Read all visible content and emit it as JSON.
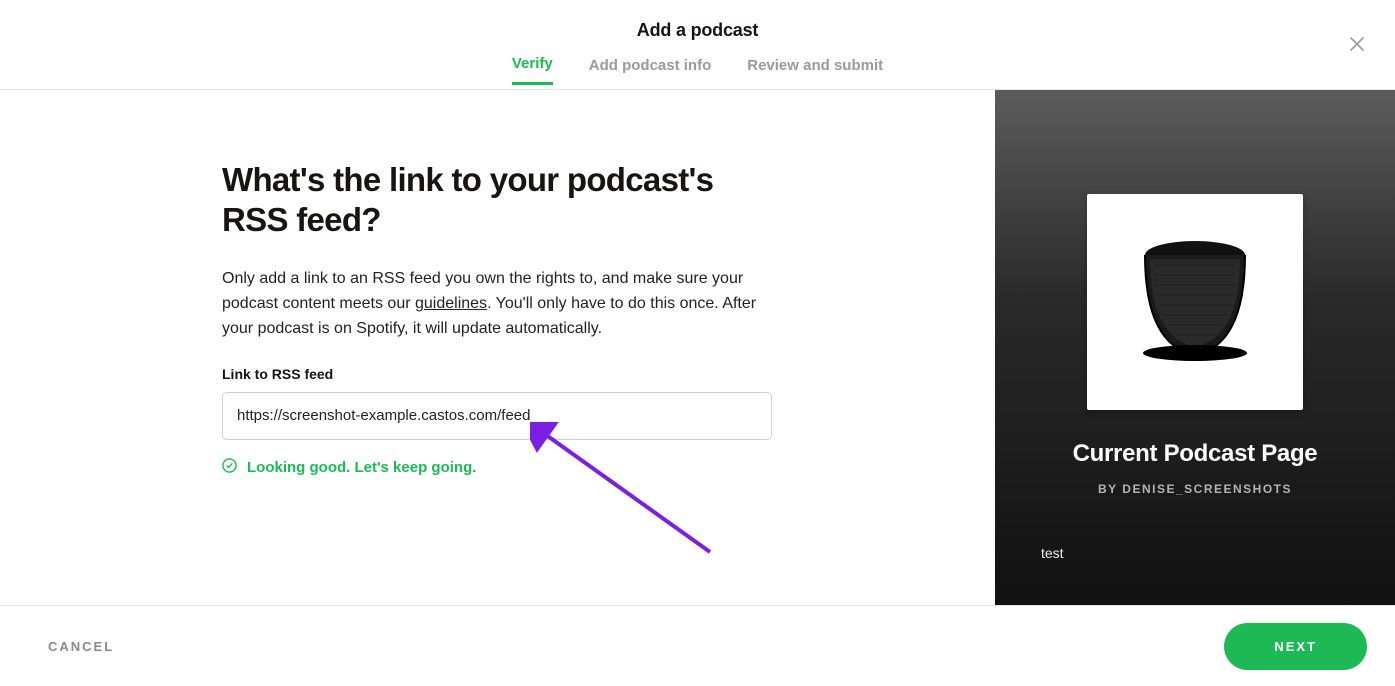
{
  "header": {
    "title": "Add a podcast",
    "steps": [
      "Verify",
      "Add podcast info",
      "Review and submit"
    ],
    "active_step_index": 0
  },
  "main": {
    "heading": "What's the link to your podcast's RSS feed?",
    "description_pre": "Only add a link to an RSS feed you own the rights to, and make sure your podcast content meets our ",
    "guidelines_link": "guidelines",
    "description_post": ". You'll only have to do this once. After your podcast is on Spotify, it will update automatically.",
    "field_label": "Link to RSS feed",
    "rss_value": "https://screenshot-example.castos.com/feed",
    "validation_message": "Looking good. Let's keep going."
  },
  "preview": {
    "title": "Current Podcast Page",
    "by_prefix": "BY ",
    "by_name": "DENISE_SCREENSHOTS",
    "description": "test"
  },
  "footer": {
    "cancel_label": "CANCEL",
    "next_label": "NEXT"
  }
}
